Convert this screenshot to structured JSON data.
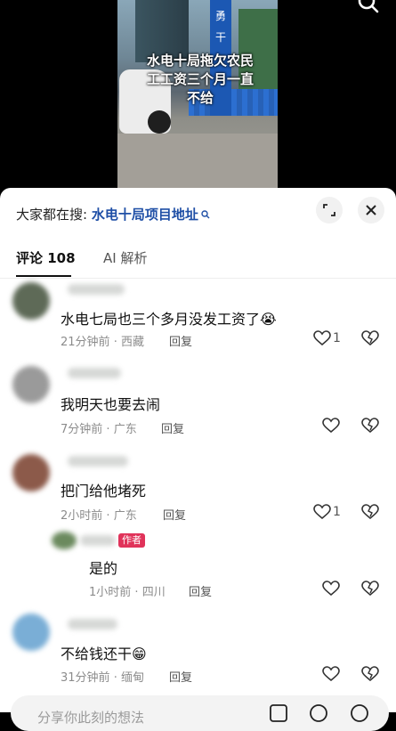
{
  "video": {
    "caption_line1": "水电十局拖欠农民",
    "caption_line2": "工工资三个月一直",
    "caption_line3": "不给",
    "sign_text": "勇 干"
  },
  "search": {
    "prefix": "大家都在搜:",
    "query": "水电十局项目地址"
  },
  "tabs": {
    "comments": "评论 108",
    "ai": "AI 解析"
  },
  "comments": [
    {
      "text": "水电七局也三个多月没发工资了",
      "emoji": "😭",
      "time": "21分钟前",
      "location": "西藏",
      "reply": "回复",
      "likes": "1"
    },
    {
      "text": "我明天也要去闹",
      "emoji": "",
      "time": "7分钟前",
      "location": "广东",
      "reply": "回复",
      "likes": ""
    },
    {
      "text": "把门给他堵死",
      "emoji": "",
      "time": "2小时前",
      "location": "广东",
      "reply": "回复",
      "likes": "1"
    },
    {
      "text": "是的",
      "emoji": "",
      "time": "1小时前",
      "location": "四川",
      "reply": "回复",
      "likes": "",
      "badge": "作者"
    },
    {
      "text": "不给钱还干",
      "emoji": "😁",
      "time": "31分钟前",
      "location": "缅甸",
      "reply": "回复",
      "likes": ""
    }
  ],
  "meta_sep": "·",
  "input": {
    "placeholder": "分享你此刻的想法"
  }
}
